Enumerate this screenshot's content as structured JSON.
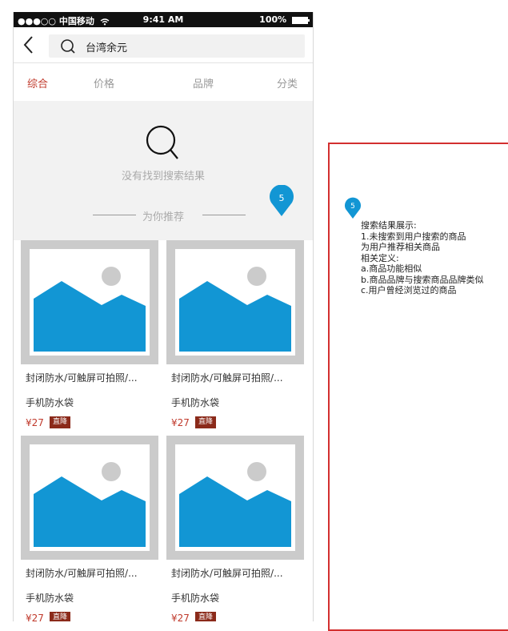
{
  "status_bar": {
    "carrier": "●●●○○ 中国移动",
    "time": "9:41 AM",
    "battery": "100%"
  },
  "search": {
    "query": "台湾余元"
  },
  "tabs": [
    {
      "label": "综合",
      "active": true
    },
    {
      "label": "价格",
      "active": false
    },
    {
      "label": "品牌",
      "active": false
    },
    {
      "label": "分类",
      "active": false
    }
  ],
  "empty_state": {
    "message": "没有找到搜索结果",
    "recommend_title": "为你推荐"
  },
  "marker": {
    "number": "5",
    "color": "#1296d4"
  },
  "products": [
    {
      "title": "封闭防水/可触屏可拍照/...",
      "subtitle": "手机防水袋",
      "price": "¥27",
      "badge": "直降"
    },
    {
      "title": "封闭防水/可触屏可拍照/...",
      "subtitle": "手机防水袋",
      "price": "¥27",
      "badge": "直降"
    },
    {
      "title": "封闭防水/可触屏可拍照/...",
      "subtitle": "手机防水袋",
      "price": "¥27",
      "badge": "直降"
    },
    {
      "title": "封闭防水/可触屏可拍照/...",
      "subtitle": "手机防水袋",
      "price": "¥27",
      "badge": "直降"
    }
  ],
  "annotation": {
    "number": "5",
    "text": "搜索结果展示:\n1.未搜索到用户搜索的商品\n为用户推荐相关商品\n相关定义:\na.商品功能相似\nb.商品品牌与搜索商品品牌类似\nc.用户曾经浏览过的商品"
  },
  "colors": {
    "accent": "#c0392b",
    "annotation_border": "#d32f2f",
    "image_placeholder": "#1296d4"
  }
}
